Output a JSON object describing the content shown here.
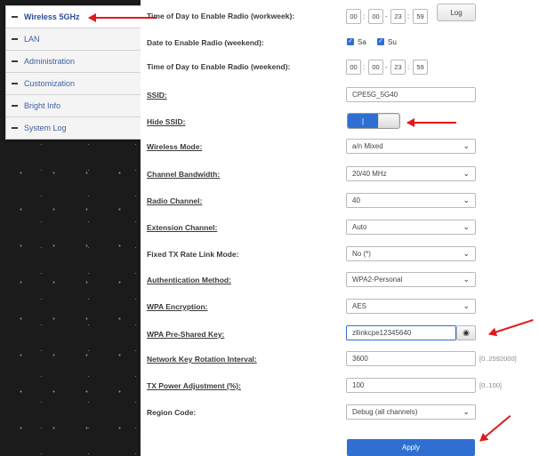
{
  "sidebar": {
    "items": [
      {
        "label": "Wireless 5GHz"
      },
      {
        "label": "LAN"
      },
      {
        "label": "Administration"
      },
      {
        "label": "Customization"
      },
      {
        "label": "Bright Info"
      },
      {
        "label": "System Log"
      }
    ]
  },
  "settings": {
    "workweek_label": "Time of Day to Enable Radio (workweek):",
    "workweek_time": [
      "00",
      "00",
      "23",
      "59"
    ],
    "log_button": "Log",
    "weekend_days_label": "Date to Enable Radio (weekend):",
    "weekend_days": [
      "Sa",
      "Su"
    ],
    "weekend_label": "Time of Day to Enable Radio (weekend):",
    "weekend_time": [
      "00",
      "00",
      "23",
      "59"
    ],
    "ssid_label": "SSID:",
    "ssid_value": "CPE5G_5G40",
    "hide_ssid_label": "Hide SSID:",
    "hide_ssid_toggle": "|",
    "wireless_mode_label": "Wireless Mode:",
    "wireless_mode_value": "a/n Mixed",
    "channel_bandwidth_label": "Channel Bandwidth:",
    "channel_bandwidth_value": "20/40 MHz",
    "radio_channel_label": "Radio Channel:",
    "radio_channel_value": "40",
    "extension_channel_label": "Extension Channel:",
    "extension_channel_value": "Auto",
    "fixed_tx_label": "Fixed TX Rate Link Mode:",
    "fixed_tx_value": "No (*)",
    "auth_method_label": "Authentication Method:",
    "auth_method_value": "WPA2-Personal",
    "wpa_encryption_label": "WPA Encryption:",
    "wpa_encryption_value": "AES",
    "psk_label": "WPA Pre-Shared Key:",
    "psk_value": "zllinkcpe12345640",
    "key_rotation_label": "Network Key Rotation Interval:",
    "key_rotation_value": "3600",
    "key_rotation_range": "[0..2592000]",
    "tx_power_label": "TX Power Adjustment (%):",
    "tx_power_value": "100",
    "tx_power_range": "[0..100]",
    "region_label": "Region Code:",
    "region_value": "Debug (all channels)",
    "apply_button": "Apply"
  },
  "colors": {
    "accent": "#2f6fd1",
    "arrow": "#e2191a",
    "sidebar_bg": "#1b1b1b"
  },
  "icons": [
    "chevron-down-icon",
    "eye-icon",
    "checkbox-checked-icon"
  ]
}
